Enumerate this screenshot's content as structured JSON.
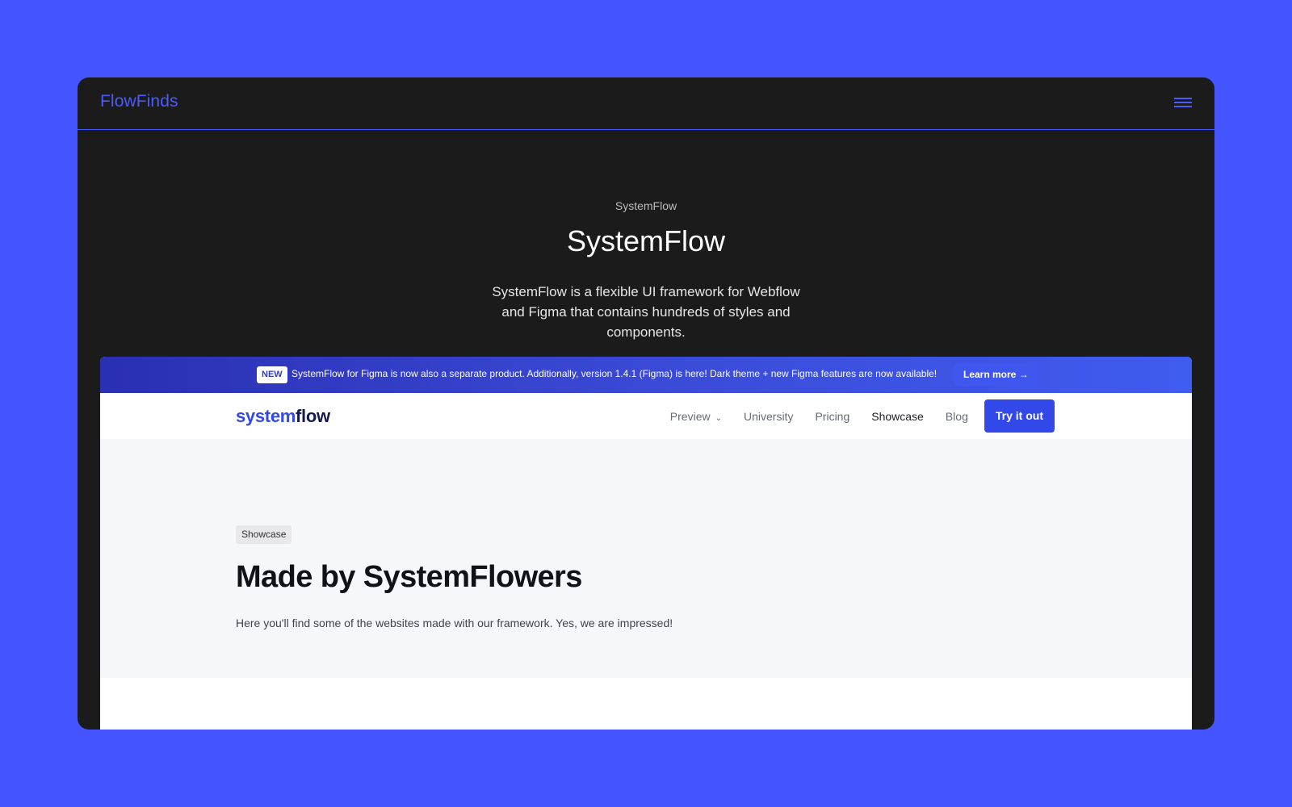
{
  "header": {
    "brand": "FlowFinds",
    "menu_icon": "hamburger-menu-icon"
  },
  "hero": {
    "eyebrow": "SystemFlow",
    "title": "SystemFlow",
    "description": "SystemFlow is a flexible UI framework for Webflow and Figma that contains hundreds of styles and components."
  },
  "preview": {
    "announcement": {
      "badge": "NEW",
      "text": "SystemFlow for Figma is now also a separate product. Additionally, version 1.4.1 (Figma) is here! Dark theme + new Figma features are now available!",
      "cta": "Learn more →"
    },
    "nav": {
      "logo_part1": "system",
      "logo_part2": "flow",
      "links": [
        "Preview",
        "University",
        "Pricing",
        "Showcase",
        "Blog"
      ],
      "active": "Showcase",
      "cta": "Try it out"
    },
    "content": {
      "tag": "Showcase",
      "title": "Made by SystemFlowers",
      "description": "Here you'll find some of the websites made with our framework. Yes, we are impressed!"
    }
  },
  "colors": {
    "background": "#4455ff",
    "card": "#1b1b1b",
    "brand": "#4a5bff",
    "primary_button": "#3348e8"
  }
}
